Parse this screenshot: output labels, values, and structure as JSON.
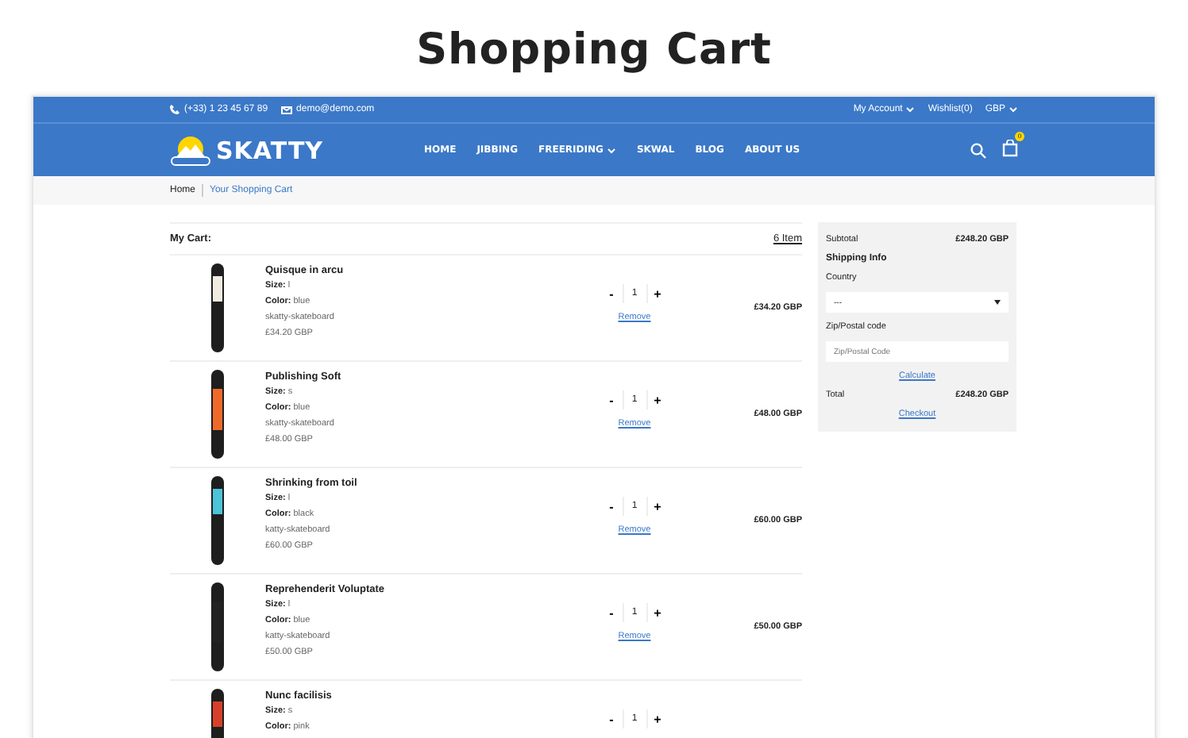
{
  "page_title": "Shopping Cart",
  "topbar": {
    "phone": "(+33) 1 23 45 67 89",
    "email": "demo@demo.com",
    "links": [
      {
        "label": "My Account",
        "dropdown": true
      },
      {
        "label": "Wishlist(0)",
        "dropdown": false
      },
      {
        "label": "GBP",
        "dropdown": true
      }
    ]
  },
  "header": {
    "logo": "SKATTY",
    "nav": [
      {
        "label": "HOME",
        "dropdown": false
      },
      {
        "label": "JIBBING",
        "dropdown": false
      },
      {
        "label": "FREERIDING",
        "dropdown": true
      },
      {
        "label": "SKWAL",
        "dropdown": false
      },
      {
        "label": "BLOG",
        "dropdown": false
      },
      {
        "label": "ABOUT US",
        "dropdown": false
      }
    ],
    "cart_count": "0"
  },
  "breadcrumb": [
    {
      "label": "Home",
      "selected": false
    },
    {
      "label": "Your Shopping Cart",
      "selected": true
    }
  ],
  "cart": {
    "title": "My Cart:",
    "count": "6 Item",
    "items": [
      {
        "name": "Quisque in arcu",
        "size_label": "Size:",
        "size": "l",
        "color_label": "Color:",
        "color_value": "blue",
        "vendor": "skatty-skateboard",
        "unit_price": "£34.20 GBP",
        "minus": "-",
        "quantity": "1",
        "plus": "+",
        "remove": "Remove",
        "total": "£34.20 GBP",
        "color": "#f0ece0"
      },
      {
        "name": "Publishing Soft",
        "size_label": "Size:",
        "size": "s",
        "color_label": "Color:",
        "color_value": "blue",
        "vendor": "skatty-skateboard",
        "unit_price": "£48.00 GBP",
        "minus": "-",
        "quantity": "1",
        "plus": "+",
        "remove": "Remove",
        "total": "£48.00 GBP",
        "color": "#ef6a2a"
      },
      {
        "name": "Shrinking from toil",
        "size_label": "Size:",
        "size": "l",
        "color_label": "Color:",
        "color_value": "black",
        "vendor": "katty-skateboard",
        "unit_price": "£60.00 GBP",
        "minus": "-",
        "quantity": "1",
        "plus": "+",
        "remove": "Remove",
        "total": "£60.00 GBP",
        "color": "#4cc3d8"
      },
      {
        "name": "Reprehenderit Voluptate",
        "size_label": "Size:",
        "size": "l",
        "color_label": "Color:",
        "color_value": "blue",
        "vendor": "katty-skateboard",
        "unit_price": "£50.00 GBP",
        "minus": "-",
        "quantity": "1",
        "plus": "+",
        "remove": "Remove",
        "total": "£50.00 GBP",
        "color": "#222222"
      },
      {
        "name": "Nunc facilisis",
        "size_label": "Size:",
        "size": "s",
        "color_label": "Color:",
        "color_value": "pink",
        "minus": "-",
        "quantity": "1",
        "plus": "+",
        "color": "#d8402a"
      }
    ]
  },
  "summary": {
    "subtotal_label": "Subtotal",
    "subtotal": "£248.20 GBP",
    "shipping_title": "Shipping Info",
    "country_label": "Country",
    "country_value": "---",
    "zip_label": "Zip/Postal code",
    "zip_placeholder": "Zip/Postal Code",
    "calculate": "Calculate",
    "total_label": "Total",
    "total": "£248.20 GBP",
    "checkout": "Checkout"
  }
}
